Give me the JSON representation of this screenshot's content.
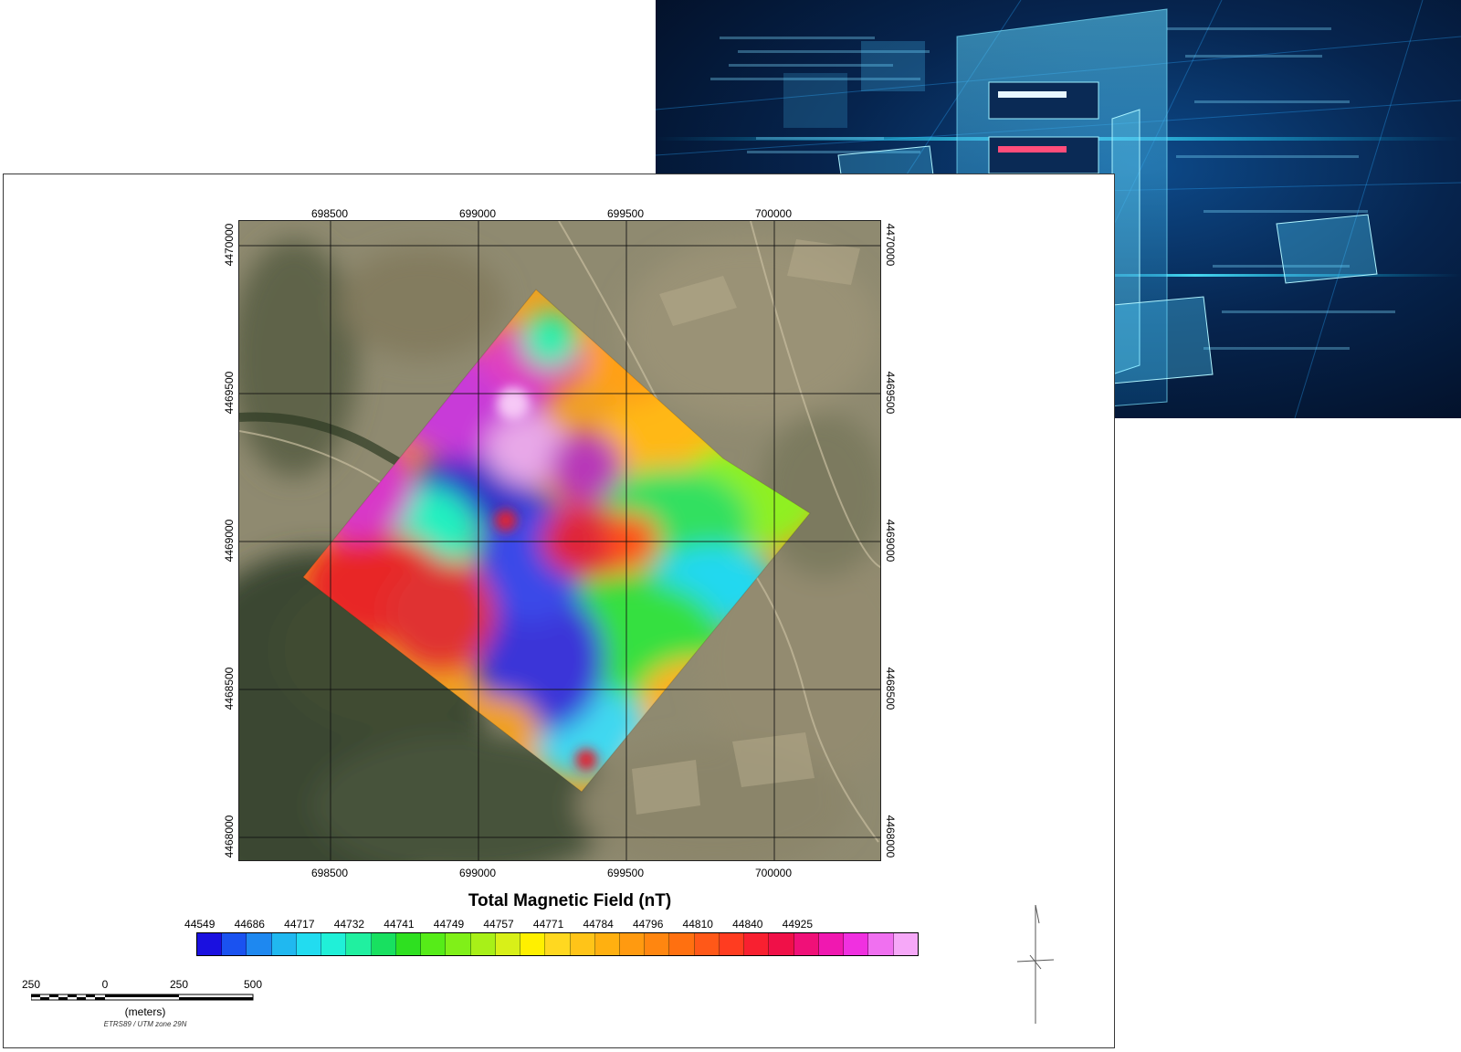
{
  "map": {
    "x_ticks": [
      "698500",
      "699000",
      "699500",
      "700000"
    ],
    "y_ticks": [
      "4470000",
      "4469500",
      "4469000",
      "4468500",
      "4468000"
    ]
  },
  "legend": {
    "title": "Total Magnetic Field (nT)",
    "labels": [
      "44549",
      "44686",
      "44717",
      "44732",
      "44741",
      "44749",
      "44757",
      "44771",
      "44784",
      "44796",
      "44810",
      "44840",
      "44925"
    ],
    "colors": [
      "#1a10e0",
      "#1a52f0",
      "#1e88f0",
      "#20b8f0",
      "#22dcf0",
      "#20f0d8",
      "#20f0a0",
      "#18e060",
      "#2ee020",
      "#56ec18",
      "#80f018",
      "#a8f018",
      "#d8f018",
      "#fff000",
      "#ffd820",
      "#ffc418",
      "#ffb010",
      "#ff9a10",
      "#ff8610",
      "#ff7010",
      "#ff5818",
      "#ff3c20",
      "#f82030",
      "#f01048",
      "#f01078",
      "#f018b0",
      "#f030e0",
      "#f070f0",
      "#f6a8f8"
    ]
  },
  "scale_bar": {
    "labels": [
      "250",
      "0",
      "250",
      "500"
    ],
    "units": "(meters)",
    "crs": "ETRS89 / UTM zone 29N"
  }
}
